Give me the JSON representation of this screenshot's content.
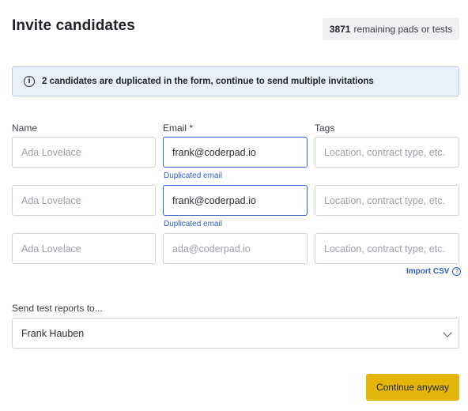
{
  "header": {
    "title": "Invite candidates",
    "remaining_count": "3871",
    "remaining_text": "remaining pads or tests"
  },
  "banner": {
    "icon": "info-icon",
    "message": "2 candidates are duplicated in the form, continue to send multiple invitations"
  },
  "columns": {
    "name": "Name",
    "email": "Email *",
    "tags": "Tags"
  },
  "rows": [
    {
      "name_placeholder": "Ada Lovelace",
      "email_value": "frank@coderpad.io",
      "tags_placeholder": "Location, contract type, etc.",
      "error": "Duplicated email"
    },
    {
      "name_placeholder": "Ada Lovelace",
      "email_value": "frank@coderpad.io",
      "tags_placeholder": "Location, contract type, etc.",
      "error": "Duplicated email"
    },
    {
      "name_placeholder": "Ada Lovelace",
      "email_placeholder": "ada@coderpad.io",
      "tags_placeholder": "Location, contract type, etc."
    }
  ],
  "import_csv": {
    "label": "Import CSV",
    "icon": "help-icon",
    "icon_glyph": "?"
  },
  "reports": {
    "label": "Send test reports to...",
    "selected": "Frank Hauben",
    "icon": "chevron-down-icon"
  },
  "actions": {
    "continue_label": "Continue anyway"
  },
  "colors": {
    "accent": "#e4b50a",
    "link": "#2f5fc4",
    "banner_bg": "#eaf0fb"
  }
}
